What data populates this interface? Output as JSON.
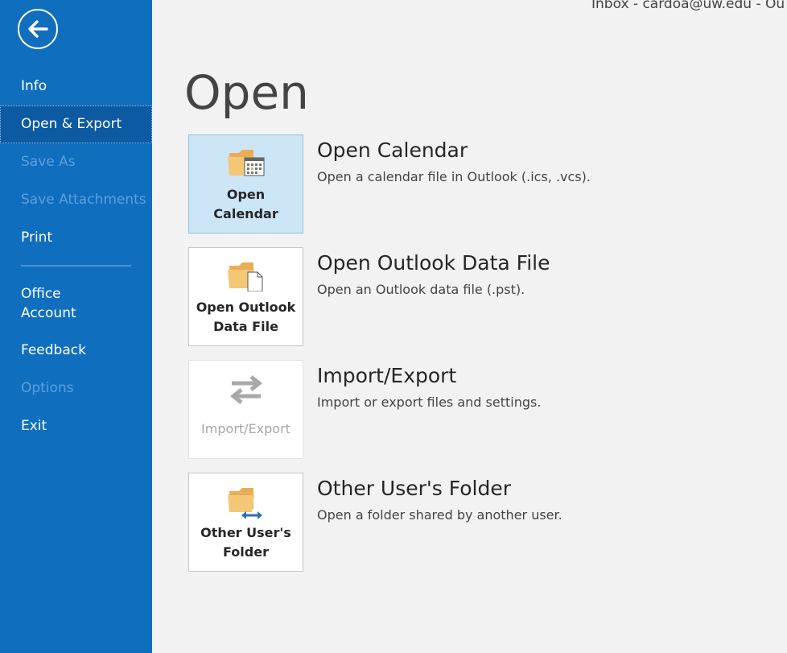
{
  "window": {
    "title": "Inbox - cardoa@uw.edu  -  Ou"
  },
  "sidebar": {
    "back_icon": "arrow-left-circle-icon",
    "items": [
      {
        "label": "Info",
        "state": "enabled"
      },
      {
        "label": "Open & Export",
        "state": "selected"
      },
      {
        "label": "Save As",
        "state": "disabled"
      },
      {
        "label": "Save Attachments",
        "state": "disabled"
      },
      {
        "label": "Print",
        "state": "enabled"
      },
      {
        "label": "Office\nAccount",
        "state": "enabled"
      },
      {
        "label": "Feedback",
        "state": "enabled"
      },
      {
        "label": "Options",
        "state": "disabled"
      },
      {
        "label": "Exit",
        "state": "enabled"
      }
    ]
  },
  "main": {
    "title": "Open",
    "options": [
      {
        "tile_label": "Open\nCalendar",
        "title": "Open Calendar",
        "description": "Open a calendar file in Outlook (.ics, .vcs).",
        "icon": "folder-calendar-icon",
        "state": "selected"
      },
      {
        "tile_label": "Open Outlook\nData File",
        "title": "Open Outlook Data File",
        "description": "Open an Outlook data file (.pst).",
        "icon": "folder-document-icon",
        "state": "enabled"
      },
      {
        "tile_label": "Import/Export",
        "title": "Import/Export",
        "description": "Import or export files and settings.",
        "icon": "import-export-arrows-icon",
        "state": "disabled"
      },
      {
        "tile_label": "Other User's\nFolder",
        "title": "Other User's Folder",
        "description": "Open a folder shared by another user.",
        "icon": "folder-shared-icon",
        "state": "enabled"
      }
    ]
  },
  "colors": {
    "sidebar_bg": "#106ebe",
    "sidebar_selected": "#0b5aa2",
    "sidebar_disabled_text": "#5aa0dc",
    "content_bg": "#f2f2f2",
    "tile_selected_bg": "#cde6f7",
    "folder_fill": "#f4c777"
  }
}
